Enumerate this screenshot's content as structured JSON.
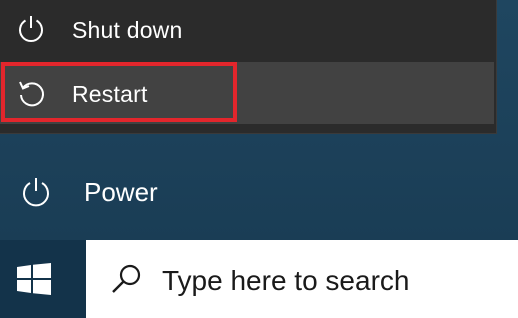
{
  "power_menu": {
    "items": [
      {
        "label": "Shut down",
        "icon": "power-icon"
      },
      {
        "label": "Restart",
        "icon": "restart-icon"
      }
    ]
  },
  "start_menu": {
    "power_label": "Power",
    "power_icon": "power-icon"
  },
  "taskbar": {
    "start_icon": "windows-logo-icon",
    "search": {
      "placeholder": "Type here to search",
      "icon": "search-icon"
    }
  },
  "colors": {
    "highlight_border": "#e3262c",
    "flyout_bg": "#2b2b2b",
    "hover_bg": "#424242",
    "start_bg": "#1f4660",
    "taskbar_bg": "#13334a"
  }
}
